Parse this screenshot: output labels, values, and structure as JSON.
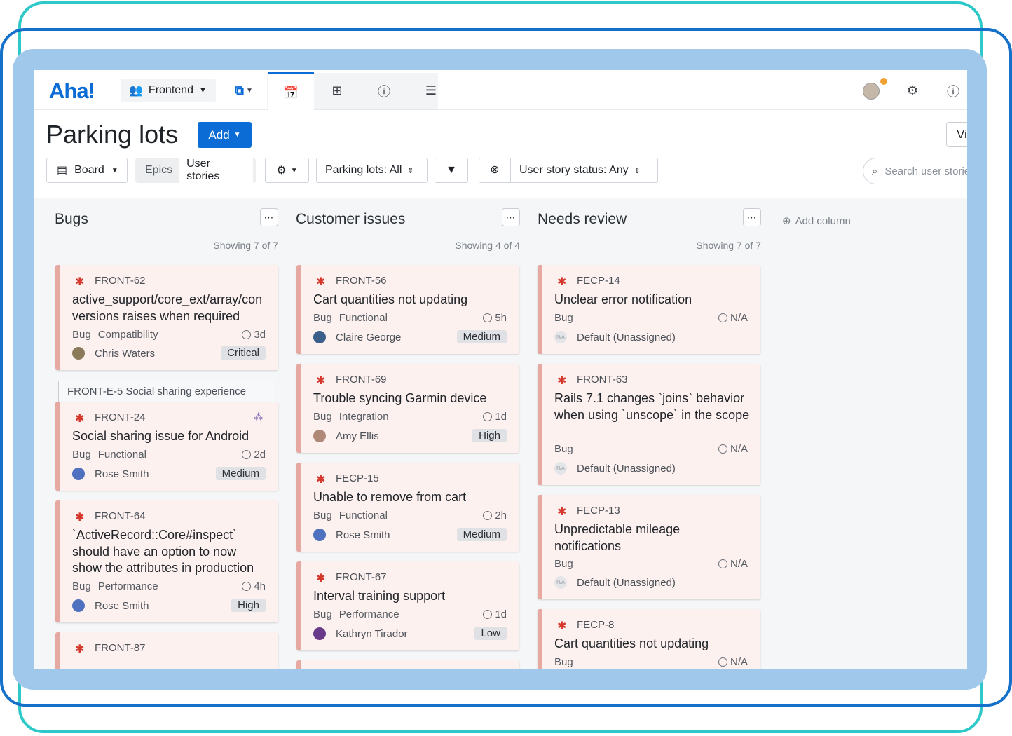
{
  "nav": {
    "logo": "Aha!",
    "workspace": "Frontend",
    "icons": [
      "team-icon",
      "caret-down-icon",
      "roadmap-icon",
      "calendar-icon",
      "grid-icon",
      "info-icon",
      "list-icon",
      "gear-icon",
      "help-icon"
    ]
  },
  "header": {
    "title": "Parking lots",
    "add_label": "Add",
    "view_label": "Vi",
    "board_label": "Board",
    "seg_epics": "Epics",
    "seg_stories": "User stories",
    "filter_parking": "Parking lots: All",
    "filter_status": "User story status: Any",
    "search_placeholder": "Search user stories"
  },
  "columns": [
    {
      "title": "Bugs",
      "showing": "Showing 7 of 7",
      "cards": [
        {
          "id": "FRONT-62",
          "title": "active_support/core_ext/array/conversions raises when required",
          "type": "Bug",
          "category": "Compatibility",
          "estimate": "3d",
          "owner": "Chris Waters",
          "priority": "Critical"
        },
        {
          "epic": "FRONT-E-5 Social sharing experience",
          "id": "FRONT-24",
          "title": "Social sharing issue for Android",
          "type": "Bug",
          "category": "Functional",
          "estimate": "2d",
          "owner": "Rose Smith",
          "priority": "Medium"
        },
        {
          "id": "FRONT-64",
          "title": "`ActiveRecord::Core#inspect` should have an option to now show the attributes in production",
          "type": "Bug",
          "category": "Performance",
          "estimate": "4h",
          "owner": "Rose Smith",
          "priority": "High"
        },
        {
          "id": "FRONT-87"
        }
      ]
    },
    {
      "title": "Customer issues",
      "showing": "Showing 4 of 4",
      "cards": [
        {
          "id": "FRONT-56",
          "title": "Cart quantities not updating",
          "type": "Bug",
          "category": "Functional",
          "estimate": "5h",
          "owner": "Claire George",
          "priority": "Medium"
        },
        {
          "id": "FRONT-69",
          "title": "Trouble syncing Garmin device",
          "type": "Bug",
          "category": "Integration",
          "estimate": "1d",
          "owner": "Amy Ellis",
          "priority": "High"
        },
        {
          "id": "FECP-15",
          "title": "Unable to remove from cart",
          "type": "Bug",
          "category": "Functional",
          "estimate": "2h",
          "owner": "Rose Smith",
          "priority": "Medium"
        },
        {
          "id": "FRONT-67",
          "title": "Interval training support",
          "type": "Bug",
          "category": "Performance",
          "estimate": "1d",
          "owner": "Kathryn Tirador",
          "priority": "Low"
        }
      ]
    },
    {
      "title": "Needs review",
      "showing": "Showing 7 of 7",
      "cards": [
        {
          "id": "FECP-14",
          "title": "Unclear error notification",
          "type": "Bug",
          "estimate": "N/A",
          "owner": "Default (Unassigned)"
        },
        {
          "id": "FRONT-63",
          "title": "Rails 7.1 changes `joins` behavior when using `unscope` in the scope",
          "type": "Bug",
          "estimate": "N/A",
          "owner": "Default (Unassigned)"
        },
        {
          "id": "FECP-13",
          "title": "Unpredictable mileage notifications",
          "type": "Bug",
          "estimate": "N/A",
          "owner": "Default (Unassigned)"
        },
        {
          "id": "FECP-8",
          "title": "Cart quantities not updating",
          "type": "Bug",
          "estimate": "N/A"
        }
      ]
    }
  ],
  "add_column": "Add column",
  "na_badge": "N/A",
  "colors": {
    "brand": "#0b6cd6",
    "card_bg": "#fdf1ef",
    "card_border": "#e6a9a1",
    "bug": "#d4382c"
  }
}
